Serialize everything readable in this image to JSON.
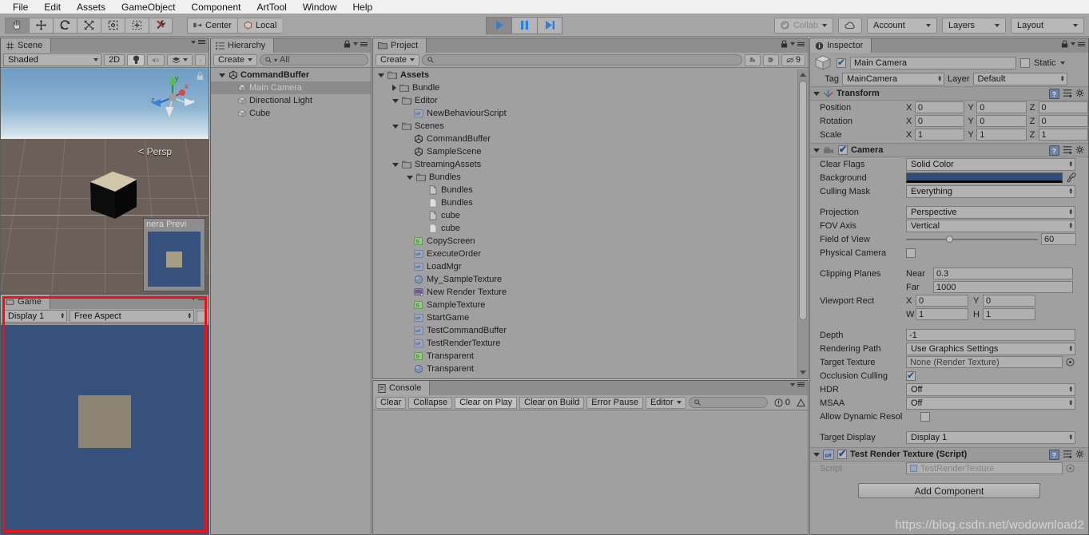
{
  "menubar": {
    "items": [
      "File",
      "Edit",
      "Assets",
      "GameObject",
      "Component",
      "ArtTool",
      "Window",
      "Help"
    ]
  },
  "toolbar": {
    "tools": [
      "hand-tool",
      "move-tool",
      "rotate-tool",
      "scale-tool",
      "rect-tool",
      "transform-tool",
      "custom-tool"
    ],
    "pivot_label": "Center",
    "space_label": "Local",
    "play_label": "play",
    "pause_label": "pause",
    "step_label": "step",
    "collab_label": "Collab",
    "cloud_label": "cloud",
    "account_label": "Account",
    "layers_label": "Layers",
    "layout_label": "Layout"
  },
  "scene": {
    "tab_label": "Scene",
    "shading_mode": "Shaded",
    "mode_2d": "2D",
    "persp_label": "Persp",
    "gizmo_axes": [
      "x",
      "y",
      "z"
    ],
    "camera_preview_title": "nera Previ"
  },
  "game": {
    "tab_label": "Game",
    "display": "Display 1",
    "aspect": "Free Aspect",
    "highlight_color": "#ee1111",
    "background_color": "#36527c"
  },
  "hierarchy": {
    "tab_label": "Hierarchy",
    "create_label": "Create",
    "search_placeholder": "All",
    "items": [
      {
        "label": "CommandBuffer",
        "depth": 0,
        "icon": "unity-scene-icon",
        "expanded": true,
        "selected": false,
        "root": true
      },
      {
        "label": "Main Camera",
        "depth": 1,
        "icon": "gameobject-icon",
        "expanded": false,
        "selected": true,
        "root": false
      },
      {
        "label": "Directional Light",
        "depth": 1,
        "icon": "gameobject-icon",
        "expanded": false,
        "selected": false,
        "root": false
      },
      {
        "label": "Cube",
        "depth": 1,
        "icon": "gameobject-icon",
        "expanded": false,
        "selected": false,
        "root": false
      }
    ]
  },
  "project": {
    "tab_label": "Project",
    "create_label": "Create",
    "search_placeholder": "",
    "hidden_count": "9",
    "items": [
      {
        "label": "Assets",
        "depth": 0,
        "icon": "folder-icon",
        "expanded": true,
        "root": true
      },
      {
        "label": "Bundle",
        "depth": 1,
        "icon": "folder-icon",
        "expanded": false,
        "root": false
      },
      {
        "label": "Editor",
        "depth": 1,
        "icon": "folder-icon",
        "expanded": true,
        "root": false
      },
      {
        "label": "NewBehaviourScript",
        "depth": 2,
        "icon": "csharp-icon",
        "expanded": null,
        "root": false
      },
      {
        "label": "Scenes",
        "depth": 1,
        "icon": "folder-icon",
        "expanded": true,
        "root": false
      },
      {
        "label": "CommandBuffer",
        "depth": 2,
        "icon": "unity-scene-icon",
        "expanded": null,
        "root": false
      },
      {
        "label": "SampleScene",
        "depth": 2,
        "icon": "unity-scene-icon",
        "expanded": null,
        "root": false
      },
      {
        "label": "StreamingAssets",
        "depth": 1,
        "icon": "folder-icon",
        "expanded": true,
        "root": false
      },
      {
        "label": "Bundles",
        "depth": 2,
        "icon": "folder-icon",
        "expanded": true,
        "root": false
      },
      {
        "label": "Bundles",
        "depth": 3,
        "icon": "file-icon",
        "expanded": null,
        "root": false
      },
      {
        "label": "Bundles",
        "depth": 3,
        "icon": "file-blank-icon",
        "expanded": null,
        "root": false
      },
      {
        "label": "cube",
        "depth": 3,
        "icon": "file-icon",
        "expanded": null,
        "root": false
      },
      {
        "label": "cube",
        "depth": 3,
        "icon": "file-blank-icon",
        "expanded": null,
        "root": false
      },
      {
        "label": "CopyScreen",
        "depth": 2,
        "icon": "shader-icon",
        "expanded": null,
        "root": false
      },
      {
        "label": "ExecuteOrder",
        "depth": 2,
        "icon": "csharp-icon",
        "expanded": null,
        "root": false
      },
      {
        "label": "LoadMgr",
        "depth": 2,
        "icon": "csharp-icon",
        "expanded": null,
        "root": false
      },
      {
        "label": "My_SampleTexture",
        "depth": 2,
        "icon": "material-icon",
        "expanded": null,
        "root": false
      },
      {
        "label": "New Render Texture",
        "depth": 2,
        "icon": "render-texture-icon",
        "expanded": null,
        "root": false
      },
      {
        "label": "SampleTexture",
        "depth": 2,
        "icon": "shader-icon",
        "expanded": null,
        "root": false
      },
      {
        "label": "StartGame",
        "depth": 2,
        "icon": "csharp-icon",
        "expanded": null,
        "root": false
      },
      {
        "label": "TestCommandBuffer",
        "depth": 2,
        "icon": "csharp-icon",
        "expanded": null,
        "root": false
      },
      {
        "label": "TestRenderTexture",
        "depth": 2,
        "icon": "csharp-icon",
        "expanded": null,
        "root": false
      },
      {
        "label": "Transparent",
        "depth": 2,
        "icon": "shader-icon",
        "expanded": null,
        "root": false
      },
      {
        "label": "Transparent",
        "depth": 2,
        "icon": "material-icon",
        "expanded": null,
        "root": false
      }
    ]
  },
  "console": {
    "tab_label": "Console",
    "buttons": [
      "Clear",
      "Collapse",
      "Clear on Play",
      "Clear on Build",
      "Error Pause"
    ],
    "editor_label": "Editor",
    "search_placeholder": "",
    "error_count": "0"
  },
  "inspector": {
    "tab_label": "Inspector",
    "object_name": "Main Camera",
    "object_enabled": true,
    "static_label": "Static",
    "tag_label": "Tag",
    "tag_value": "MainCamera",
    "layer_label": "Layer",
    "layer_value": "Default",
    "transform": {
      "title": "Transform",
      "rows": [
        {
          "label": "Position",
          "x": "0",
          "y": "0",
          "z": "0"
        },
        {
          "label": "Rotation",
          "x": "0",
          "y": "0",
          "z": "0"
        },
        {
          "label": "Scale",
          "x": "1",
          "y": "1",
          "z": "1"
        }
      ]
    },
    "camera": {
      "title": "Camera",
      "enabled": true,
      "clear_flags_label": "Clear Flags",
      "clear_flags_value": "Solid Color",
      "background_label": "Background",
      "background_color": "#2f4d7a",
      "culling_mask_label": "Culling Mask",
      "culling_mask_value": "Everything",
      "projection_label": "Projection",
      "projection_value": "Perspective",
      "fov_axis_label": "FOV Axis",
      "fov_axis_value": "Vertical",
      "field_of_view_label": "Field of View",
      "field_of_view_value": "60",
      "physical_camera_label": "Physical Camera",
      "physical_camera_checked": false,
      "clipping_planes_label": "Clipping Planes",
      "near_label": "Near",
      "near_value": "0.3",
      "far_label": "Far",
      "far_value": "1000",
      "viewport_rect_label": "Viewport Rect",
      "viewport_x": "0",
      "viewport_y": "0",
      "viewport_w": "1",
      "viewport_h": "1",
      "depth_label": "Depth",
      "depth_value": "-1",
      "rendering_path_label": "Rendering Path",
      "rendering_path_value": "Use Graphics Settings",
      "target_texture_label": "Target Texture",
      "target_texture_value": "None (Render Texture)",
      "occlusion_culling_label": "Occlusion Culling",
      "occlusion_culling_checked": true,
      "hdr_label": "HDR",
      "hdr_value": "Off",
      "msaa_label": "MSAA",
      "msaa_value": "Off",
      "dynamic_res_label": "Allow Dynamic Resol",
      "dynamic_res_checked": false,
      "target_display_label": "Target Display",
      "target_display_value": "Display 1"
    },
    "script_component": {
      "title": "Test Render Texture (Script)",
      "enabled": true,
      "script_label": "Script",
      "script_value": "TestRenderTexture"
    },
    "add_component_label": "Add Component"
  },
  "watermark": "https://blog.csdn.net/wodownload2"
}
